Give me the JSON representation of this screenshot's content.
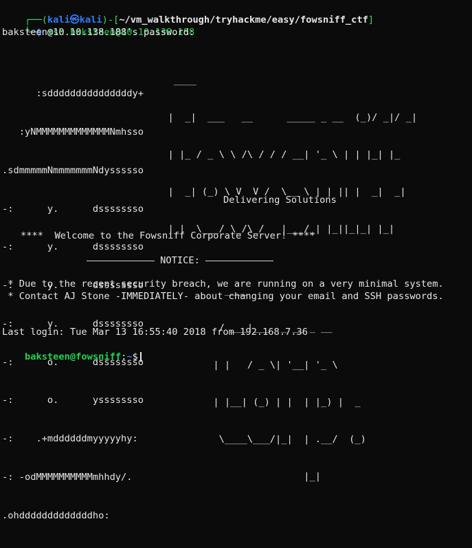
{
  "prompt1": {
    "user": "kali",
    "host": "kali",
    "path": "~/vm_walkthrough/tryhackme/easy/fowsniff_ctf",
    "command": "ssh baksteen@10.10.138.188"
  },
  "password_prompt": "baksteen@10.10.138.188's password:",
  "banner": {
    "left_art": [
      "      :sdddddddddddddddy+",
      "   :yNMMMMMMMMMMMMMNmhsso",
      ".sdmmmmmNmmmmmmmNdyssssso",
      "-:      y.      dssssssso",
      "-:      y.      dssssssso",
      "-:      y.      dssssssso",
      "-:      y.      dssssssso",
      "-:      o.      dssssssso",
      "-:      o.      yssssssso",
      "-:    .+mddddddmyyyyyhy:",
      "-: -odMMMMMMMMMMmhhdy/.",
      ".ohdddddddddddddho:"
    ],
    "right_art": [
      "   ____",
      "  |  _|  ___   __      _____ _ __  (_)/ _|/ _|",
      "  | |_ / _ \\ \\ /\\ / / / __| '_ \\ | | |_| |_",
      "  |  _| (_) \\ V  V /  \\__ \\ | | || |  _|  _|",
      "  |_|  \\___/ \\_/\\_/   |___/_| |_||_|_| |_|",
      "",
      "            ____",
      "           / ___|___  _ __ _ __",
      "          | |   / _ \\| '__| '_ \\",
      "          | |__| (_) | |  | |_) |  _",
      "           \\____\\___/|_|  | .__/  (_)",
      "                          |_|"
    ],
    "tagline": "Delivering Solutions"
  },
  "welcome": "****  Welcome to the Fowsniff Corporate Server! ****",
  "notice": "———————————— NOTICE: ————————————",
  "notices": [
    " * Due to the recent security breach, we are running on a very minimal system.",
    " * Contact AJ Stone -IMMEDIATELY- about changing your email and SSH passwords."
  ],
  "last_login": "Last login: Tue Mar 13 16:55:40 2018 from 192.168.7.36",
  "prompt2": {
    "userhost": "baksteen@fowsniff",
    "sep": ":",
    "path": "~",
    "symbol": "$"
  },
  "colors": {
    "background": "#0b0b0b",
    "kali_blue": "#2f7cf6",
    "kali_green": "#3cd86b",
    "prompt_green": "#24d14f",
    "text": "#e6e6e6"
  }
}
